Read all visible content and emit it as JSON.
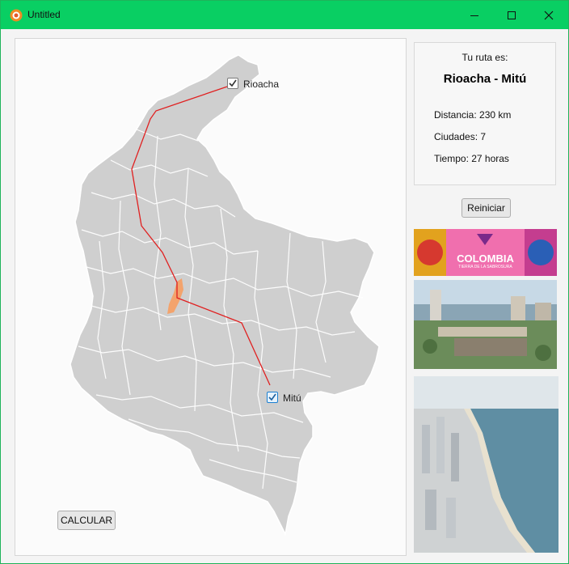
{
  "window": {
    "title": "Untitled"
  },
  "map": {
    "origin_city": "Rioacha",
    "destination_city": "Mitú",
    "calculate_label": "CALCULAR"
  },
  "info": {
    "heading": "Tu ruta es:",
    "route": "Rioacha - Mitú",
    "distance": "Distancia: 230 km",
    "cities": "Ciudades: 7",
    "time": "Tiempo: 27 horas"
  },
  "reset_label": "Reiniciar",
  "banner": {
    "title": "COLOMBIA",
    "subtitle": "TIERRA DE LA SABROSURA"
  },
  "colors": {
    "titlebar": "#09cf63",
    "route_line": "#e02020",
    "map_fill": "#cfcfcf"
  }
}
